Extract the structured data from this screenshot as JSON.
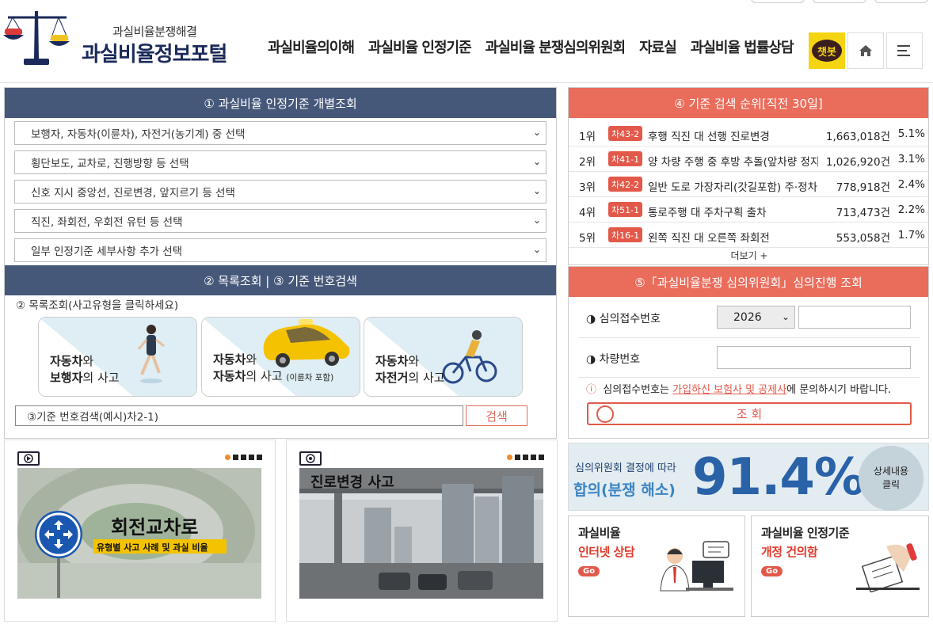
{
  "header": {
    "logo_sub": "과실비율분쟁해결",
    "logo_title": "과실비율정보포털",
    "nav": [
      "과실비율의이해",
      "과실비율 인정기준",
      "과실비율 분쟁심의위원회",
      "자료실",
      "과실비율 법률상담"
    ],
    "chatbot_label": "챗봇"
  },
  "panel1": {
    "title": "① 과실비율 인정기준 개별조회",
    "selects": [
      "보행자, 자동차(이륜차), 자전거(농기계) 중 선택",
      "횡단보도, 교차로, 진행방향 등 선택",
      "신호 지시 중앙선, 진로변경, 앞지르기 등 선택",
      "직진, 좌회전, 우회전 유턴 등 선택",
      "일부 인정기준 세부사항 추가 선택"
    ],
    "title2": "② 목록조회 | ③ 기준 번호검색",
    "list_label": "② 목록조회(사고유형을 클릭하세요)",
    "cards": [
      {
        "a": "자동차",
        "wa": "와",
        "b": "보행자",
        "rest": "의 사고",
        "note": ""
      },
      {
        "a": "자동차",
        "wa": "와",
        "b": "자동차",
        "rest": "의 사고",
        "note": "(이륜차 포함)"
      },
      {
        "a": "자동차",
        "wa": "와",
        "b": "자전거",
        "rest": "의 사고",
        "note": ""
      }
    ],
    "search_placeholder": "③기준 번호검색(예시)차2-1)",
    "search_button": "검색"
  },
  "videos": [
    {
      "caption_main": "회전교차로",
      "caption_sub": "유형별 사고 사례 및 과실 비율"
    },
    {
      "caption_main": "진로변경 사고",
      "caption_sub": ""
    }
  ],
  "rank": {
    "title": "④ 기준 검색 순위[직전 30일]",
    "items": [
      {
        "rank": "1위",
        "code": "차43-2",
        "title": "후행 직진 대 선행 진로변경",
        "count": "1,663,018건",
        "pct": "5.1%"
      },
      {
        "rank": "2위",
        "code": "차41-1",
        "title": "양 차량 주행 중 후방 추돌(앞차량 정지",
        "count": "1,026,920건",
        "pct": "3.1%"
      },
      {
        "rank": "3위",
        "code": "차42-2",
        "title": "일반 도로 가장자리(갓길포함) 주·정차",
        "count": "778,918건",
        "pct": "2.4%"
      },
      {
        "rank": "4위",
        "code": "차51-1",
        "title": "통로주행 대 주차구획 출차",
        "count": "713,473건",
        "pct": "2.2%"
      },
      {
        "rank": "5위",
        "code": "차16-1",
        "title": "왼쪽 직진 대 오른쪽 좌회전",
        "count": "553,058건",
        "pct": "1.7%"
      }
    ],
    "more": "더보기 +"
  },
  "lookup": {
    "title": "⑤「과실비율분쟁 심의위원회」심의진행 조회",
    "label_receipt": "◑ 심의접수번호",
    "year": "2026",
    "label_car": "◑ 차량번호",
    "notice_icon": "ⓘ",
    "notice_pre": "심의접수번호는",
    "notice_link": "가입하신 보험사 및 공제사",
    "notice_post": "에 문의하시기 바랍니다.",
    "button": "조 회"
  },
  "stat": {
    "small": "심의위원회 결정에 따라",
    "big": "합의(분쟁 해소)",
    "pct": "91.4%",
    "circle_line1": "상세내용",
    "circle_line2": "클릭"
  },
  "promos": [
    {
      "l1": "과실비율",
      "l2": "인터넷 상담",
      "go": "Go"
    },
    {
      "l1": "과실비율 인정기준",
      "l2": "개정 건의함",
      "go": "Go"
    }
  ],
  "colors": {
    "navy": "#46587a",
    "coral": "#ea6c5b",
    "accent_blue": "#2a62a8"
  }
}
